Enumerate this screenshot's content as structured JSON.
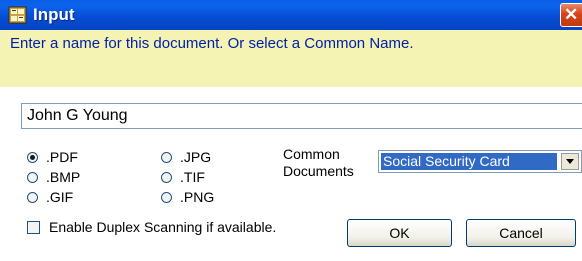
{
  "window": {
    "title": "Input",
    "close_glyph": "✕"
  },
  "prompt": "Enter a name for this document.  Or select a Common Name.",
  "name_input": {
    "value": "John G Young"
  },
  "formats": [
    {
      "label": ".PDF",
      "selected": true
    },
    {
      "label": ".BMP",
      "selected": false
    },
    {
      "label": ".GIF",
      "selected": false
    },
    {
      "label": ".JPG",
      "selected": false
    },
    {
      "label": ".TIF",
      "selected": false
    },
    {
      "label": ".PNG",
      "selected": false
    }
  ],
  "common_documents": {
    "label_line1": "Common",
    "label_line2": "Documents",
    "selected": "Social Security Card"
  },
  "duplex": {
    "label": "Enable Duplex Scanning if available.",
    "checked": false
  },
  "buttons": {
    "ok": "OK",
    "cancel": "Cancel"
  },
  "colors": {
    "title_bar": "#0a5ee6",
    "prompt_band": "#f4f3b4",
    "prompt_text": "#0020a8",
    "selection": "#316ac5"
  }
}
